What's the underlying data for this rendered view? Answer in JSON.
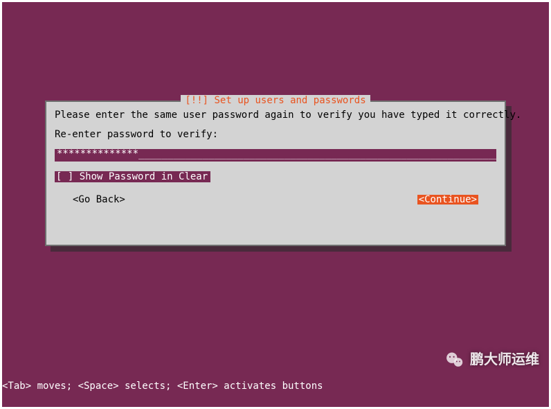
{
  "dialog": {
    "title_prefix": "[!!] ",
    "title": "Set up users and passwords",
    "instruction": "Please enter the same user password again to verify you have typed it correctly.",
    "field_label": "Re-enter password to verify:",
    "password_masked": "**************",
    "checkbox_state": "[ ]",
    "checkbox_label": "Show Password in Clear",
    "back_label": "<Go Back>",
    "continue_label": "<Continue>"
  },
  "statusbar": "<Tab> moves; <Space> selects; <Enter> activates buttons",
  "watermark": "鹏大师运维",
  "colors": {
    "aubergine": "#772953",
    "orange": "#e95420",
    "panel": "#d3d3d3"
  }
}
